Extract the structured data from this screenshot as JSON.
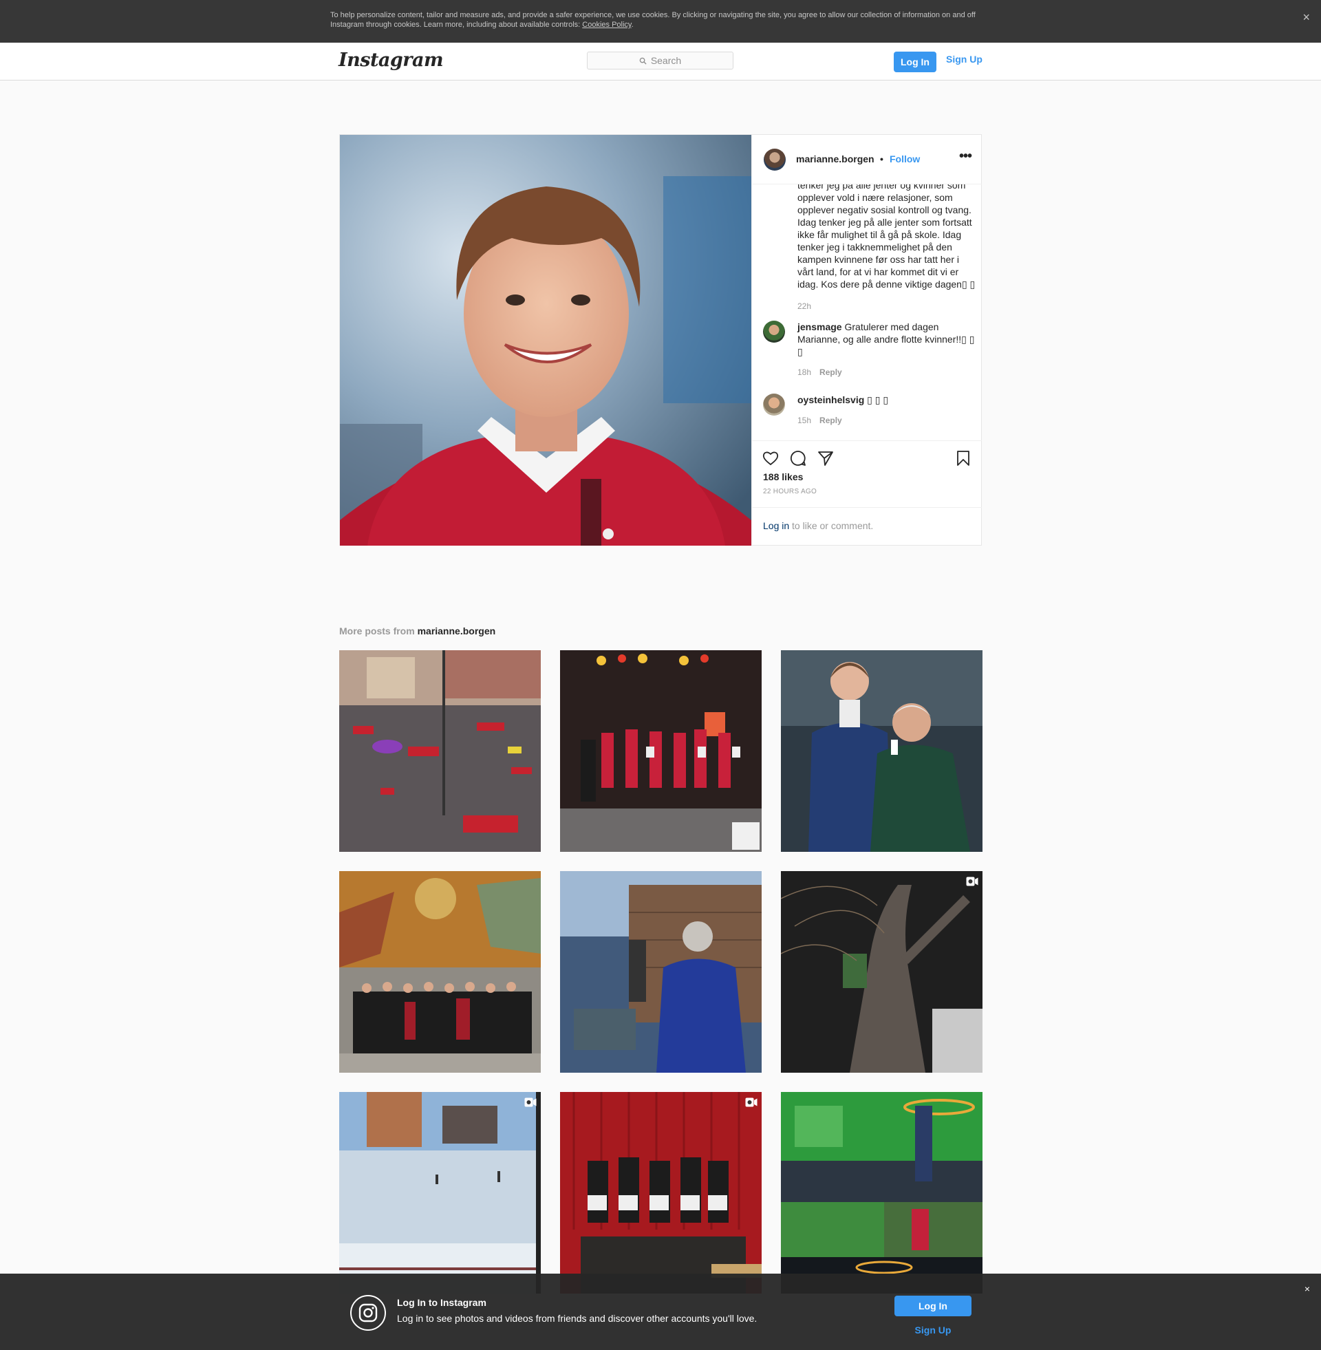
{
  "cookie_banner": {
    "text": "To help personalize content, tailor and measure ads, and provide a safer experience, we use cookies. By clicking or navigating the site, you agree to allow our collection of information on and off Instagram through cookies. Learn more, including about available controls: ",
    "link": "Cookies Policy",
    "suffix": ".",
    "close_icon": "×"
  },
  "nav": {
    "logo": "Instagram",
    "search_placeholder": "Search",
    "login": "Log In",
    "signup": "Sign Up"
  },
  "post": {
    "username": "marianne.borgen",
    "dot": "•",
    "follow": "Follow",
    "more": "•••",
    "caption": "tenker jeg på alle jenter og kvinner som opplever vold i nære relasjoner, som opplever negativ sosial kontroll og tvang. Idag tenker jeg på alle jenter som fortsatt ikke får mulighet til å gå på skole. Idag tenker jeg i takknemmelighet på den kampen kvinnene før oss har tatt her i vårt land, for at vi har kommet dit vi er idag. Kos dere på denne viktige dagen▯ ▯",
    "caption_time": "22h",
    "comments": [
      {
        "user": "jensmage",
        "text": "Gratulerer med dagen Marianne, og alle andre flotte kvinner!!▯ ▯ ▯",
        "time": "18h",
        "reply": "Reply"
      },
      {
        "user": "oysteinhelsvig",
        "text": "▯ ▯ ▯",
        "time": "15h",
        "reply": "Reply"
      }
    ],
    "likes": "188 likes",
    "ago": "22 HOURS AGO",
    "login_link": "Log in",
    "login_rest": " to like or comment."
  },
  "more_posts": {
    "prefix": "More posts from ",
    "username": "marianne.borgen"
  },
  "bottom_bar": {
    "title": "Log In to Instagram",
    "subtitle": "Log in to see photos and videos from friends and discover other accounts you'll love.",
    "login": "Log In",
    "signup": "Sign Up",
    "close_icon": "×"
  },
  "colors": {
    "accent": "#3897f0",
    "text": "#262626",
    "muted": "#999999"
  },
  "icons": [
    "search-icon",
    "heart-icon",
    "comment-icon",
    "share-icon",
    "bookmark-icon",
    "video-icon",
    "instagram-glyph-icon",
    "close-icon"
  ]
}
